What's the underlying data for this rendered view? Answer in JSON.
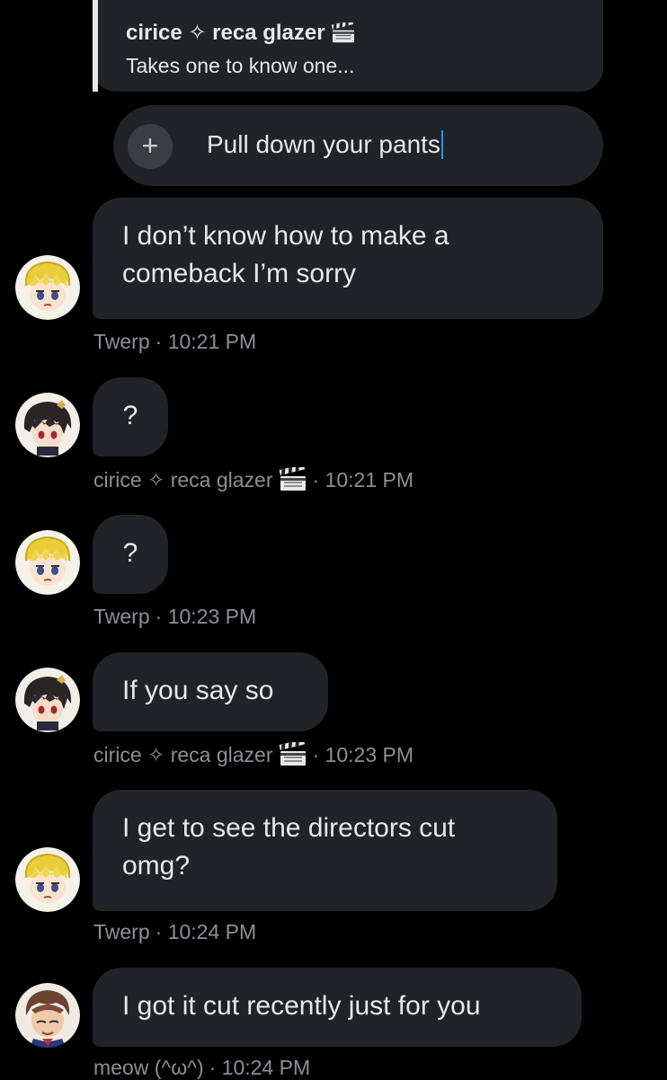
{
  "quote": {
    "author": "cirice ✧ reca glazer",
    "author_icon": "clapperboard-icon",
    "text": "Takes one to know one..."
  },
  "composer": {
    "add_icon": "+",
    "value": "Pull down your pants"
  },
  "messages": [
    {
      "text_lines": [
        "I don’t know how to make a",
        "comeback I’m sorry"
      ],
      "sender": "Twerp",
      "time": "· 10:21 PM",
      "avatar": "blonde-avatar"
    },
    {
      "text_lines": [
        "?"
      ],
      "sender": "cirice ✧ reca glazer",
      "sender_icon": "clapperboard-icon",
      "time": "· 10:21 PM",
      "avatar": "dark-hair-avatar"
    },
    {
      "text_lines": [
        "?"
      ],
      "sender": "Twerp",
      "time": "· 10:23 PM",
      "avatar": "blonde-avatar"
    },
    {
      "text_lines": [
        "If you say so"
      ],
      "sender": "cirice ✧ reca glazer",
      "sender_icon": "clapperboard-icon",
      "time": "· 10:23 PM",
      "avatar": "dark-hair-avatar"
    },
    {
      "text_lines": [
        "I get to see the directors cut",
        "omg?"
      ],
      "sender": "Twerp",
      "time": "· 10:24 PM",
      "avatar": "blonde-avatar"
    },
    {
      "text_lines": [
        "I got it cut recently just for you"
      ],
      "sender": "meow (^ω^)",
      "time": "· 10:24 PM",
      "avatar": "brown-hair-avatar"
    }
  ],
  "colors": {
    "background": "#000000",
    "bubble": "#202327",
    "text": "#e7e9ea",
    "meta": "#8b9096",
    "caret": "#1d9bf0"
  }
}
